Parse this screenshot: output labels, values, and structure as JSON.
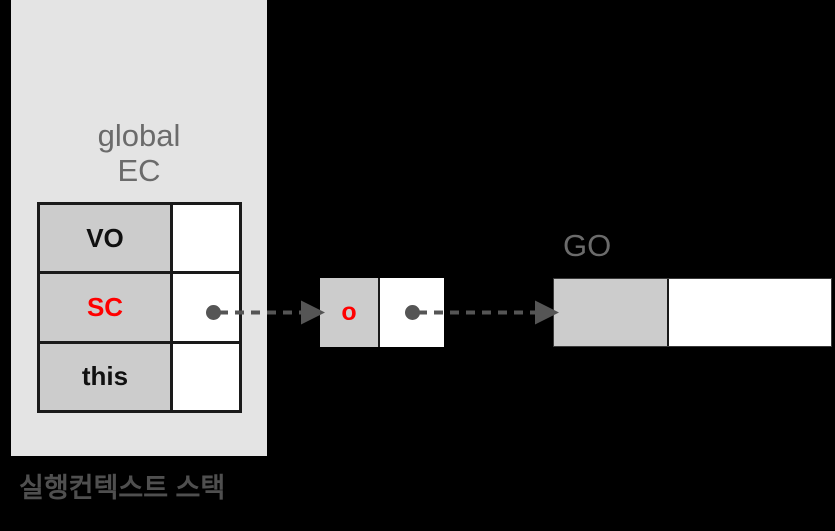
{
  "diagram": {
    "caption": "실행컨텍스트 스택",
    "colors": {
      "background": "#000000",
      "panel": "#e4e4e4",
      "cell_key": "#cccccc",
      "cell_value": "#ffffff",
      "border": "#1a1a1a",
      "label_gray": "#6b6b6b",
      "caption_gray": "#4f4f4f",
      "highlight_red": "#ff0000",
      "connector_gray": "#555555"
    }
  },
  "execution_context": {
    "title": "global\nEC",
    "rows": [
      {
        "key": "VO",
        "value": "",
        "highlighted": false,
        "has_pointer": false
      },
      {
        "key": "SC",
        "value": "",
        "highlighted": true,
        "has_pointer": true
      },
      {
        "key": "this",
        "value": "",
        "highlighted": false,
        "has_pointer": false
      }
    ]
  },
  "scope_chain_object": {
    "key": "o",
    "value": "",
    "key_highlighted": true,
    "has_pointer": true
  },
  "global_object": {
    "title": "GO",
    "key": "",
    "value": ""
  },
  "connectors": [
    {
      "from": "sc-pointer",
      "to": "scope-chain-object",
      "style": "dashed-arrow"
    },
    {
      "from": "scope-chain-pointer",
      "to": "global-object",
      "style": "dashed-arrow"
    }
  ]
}
